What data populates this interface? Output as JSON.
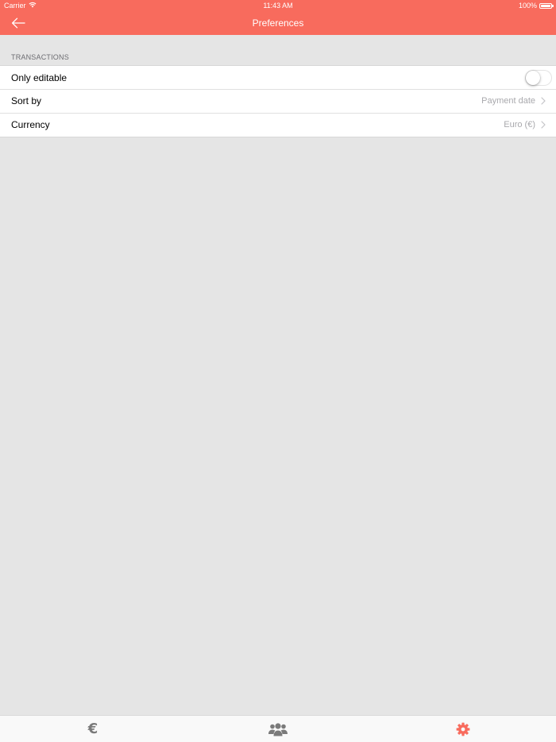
{
  "status_bar": {
    "carrier": "Carrier",
    "time": "11:43 AM",
    "battery": "100%",
    "battery_level": 1.0
  },
  "nav": {
    "title": "Preferences",
    "back_icon": "arrow-left-icon"
  },
  "transactions": {
    "header": "TRANSACTIONS",
    "only_editable": {
      "label": "Only editable",
      "enabled": false
    },
    "sort_by": {
      "label": "Sort by",
      "value": "Payment date"
    },
    "currency": {
      "label": "Currency",
      "value": "Euro  (€)"
    }
  },
  "tab_bar": {
    "items": [
      {
        "icon": "euro-icon",
        "glyph": "€",
        "selected": false
      },
      {
        "icon": "people-icon",
        "selected": false
      },
      {
        "icon": "gear-icon",
        "selected": true
      }
    ]
  },
  "colors": {
    "accent": "#f86b5d",
    "tab_inactive": "#7a7a7a",
    "background": "#e5e5e5",
    "secondary_text": "#a9a9ad"
  }
}
